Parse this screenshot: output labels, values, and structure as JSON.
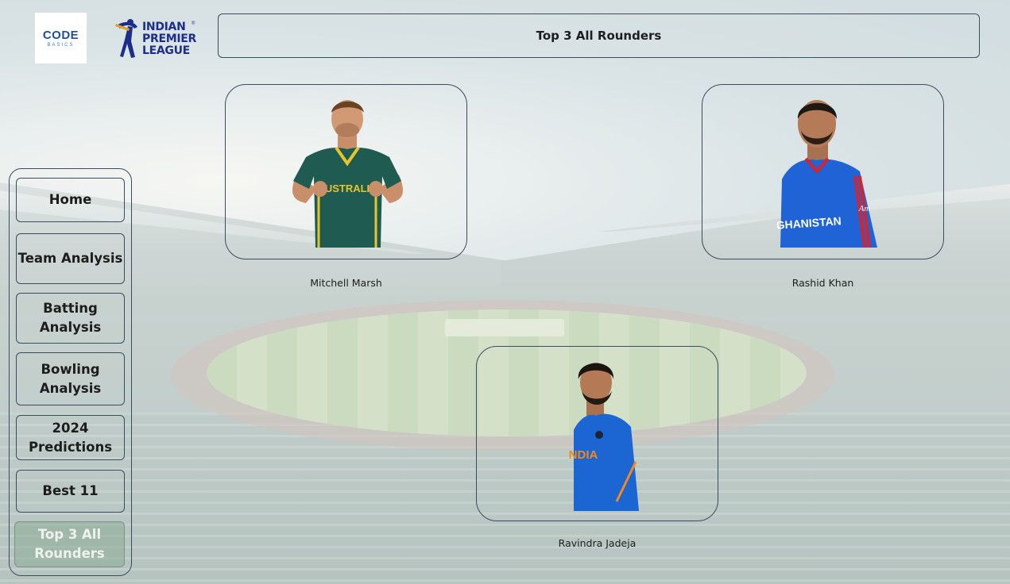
{
  "brand": {
    "code_logo_main": "CODE",
    "code_logo_sub": "BASICS",
    "ipl_line1": "INDIAN",
    "ipl_line2": "PREMIER",
    "ipl_line3": "LEAGUE",
    "ipl_tm": "®"
  },
  "header": {
    "title": "Top 3 All Rounders"
  },
  "sidebar": {
    "items": [
      {
        "label": "Home",
        "active": false
      },
      {
        "label": "Team Analysis",
        "active": false
      },
      {
        "label": "Batting Analysis",
        "active": false
      },
      {
        "label": "Bowling Analysis",
        "active": false
      },
      {
        "label": "2024 Predictions",
        "active": false
      },
      {
        "label": "Best 11",
        "active": false
      },
      {
        "label": "Top 3 All Rounders",
        "active": true
      }
    ]
  },
  "players": [
    {
      "name": "Mitchell Marsh",
      "jersey_text": "AUSTRALIA",
      "jersey_color": "#1f5b50",
      "accent_color": "#e8c52a"
    },
    {
      "name": "Rashid Khan",
      "jersey_text": "GHANISTAN",
      "jersey_color": "#1f63d6",
      "accent_color": "#d8232a",
      "sponsor_text": "Am"
    },
    {
      "name": "Ravindra Jadeja",
      "jersey_text": "NDIA",
      "jersey_color": "#1b66d2",
      "accent_color": "#f08a1c"
    }
  ]
}
